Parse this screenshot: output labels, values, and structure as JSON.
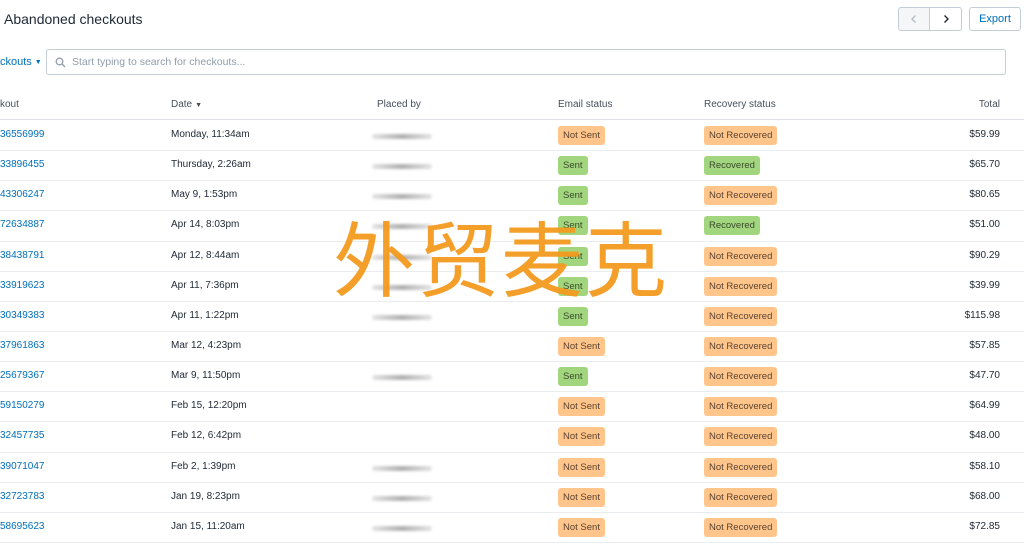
{
  "page": {
    "title": "Abandoned checkouts"
  },
  "toolbar": {
    "prev_icon": "chevron-left-icon",
    "next_icon": "chevron-right-icon",
    "export_label": "Export"
  },
  "filter": {
    "dropdown_label": "ckouts",
    "search_placeholder": "Start typing to search for checkouts..."
  },
  "table": {
    "headers": {
      "checkout": "kout",
      "date": "Date",
      "placed_by": "Placed by",
      "email_status": "Email status",
      "recovery_status": "Recovery status",
      "total": "Total"
    },
    "rows": [
      {
        "id": "36556999",
        "date": "Monday, 11:34am",
        "email": "Not Sent",
        "recovery": "Not Recovered",
        "total": "$59.99"
      },
      {
        "id": "33896455",
        "date": "Thursday, 2:26am",
        "email": "Sent",
        "recovery": "Recovered",
        "total": "$65.70"
      },
      {
        "id": "43306247",
        "date": "May 9, 1:53pm",
        "email": "Sent",
        "recovery": "Not Recovered",
        "total": "$80.65"
      },
      {
        "id": "72634887",
        "date": "Apr 14, 8:03pm",
        "email": "Sent",
        "recovery": "Recovered",
        "total": "$51.00"
      },
      {
        "id": "38438791",
        "date": "Apr 12, 8:44am",
        "email": "Sent",
        "recovery": "Not Recovered",
        "total": "$90.29"
      },
      {
        "id": "33919623",
        "date": "Apr 11, 7:36pm",
        "email": "Sent",
        "recovery": "Not Recovered",
        "total": "$39.99"
      },
      {
        "id": "30349383",
        "date": "Apr 11, 1:22pm",
        "email": "Sent",
        "recovery": "Not Recovered",
        "total": "$115.98"
      },
      {
        "id": "37961863",
        "date": "Mar 12, 4:23pm",
        "email": "Not Sent",
        "recovery": "Not Recovered",
        "total": "$57.85"
      },
      {
        "id": "25679367",
        "date": "Mar 9, 11:50pm",
        "email": "Sent",
        "recovery": "Not Recovered",
        "total": "$47.70"
      },
      {
        "id": "59150279",
        "date": "Feb 15, 12:20pm",
        "email": "Not Sent",
        "recovery": "Not Recovered",
        "total": "$64.99"
      },
      {
        "id": "32457735",
        "date": "Feb 12, 6:42pm",
        "email": "Not Sent",
        "recovery": "Not Recovered",
        "total": "$48.00"
      },
      {
        "id": "39071047",
        "date": "Feb 2, 1:39pm",
        "email": "Not Sent",
        "recovery": "Not Recovered",
        "total": "$58.10"
      },
      {
        "id": "32723783",
        "date": "Jan 19, 8:23pm",
        "email": "Not Sent",
        "recovery": "Not Recovered",
        "total": "$68.00"
      },
      {
        "id": "58695623",
        "date": "Jan 15, 11:20am",
        "email": "Not Sent",
        "recovery": "Not Recovered",
        "total": "$72.85"
      }
    ]
  },
  "placed_by_blurred": [
    true,
    true,
    true,
    true,
    true,
    true,
    true,
    false,
    true,
    false,
    false,
    true,
    true,
    true
  ],
  "watermark": "外贸麦克",
  "colors": {
    "link": "#006fbb",
    "badge_warning": "#ffc58b",
    "badge_success": "#a2d67e",
    "watermark": "#f49a1f"
  }
}
